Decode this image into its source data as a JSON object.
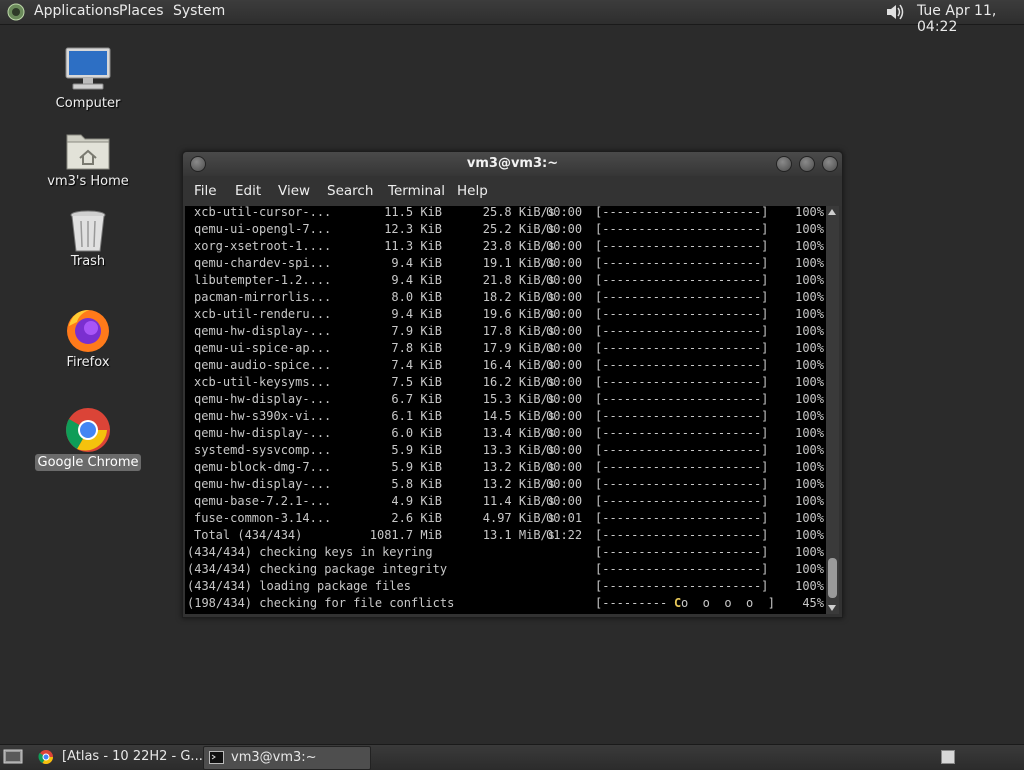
{
  "top_panel": {
    "menus": [
      "Applications",
      "Places",
      "System"
    ],
    "clock": "Tue Apr 11, 04:22"
  },
  "desktop_icons": [
    {
      "label": "Computer",
      "icon": "computer-icon"
    },
    {
      "label": "vm3's Home",
      "icon": "home-folder-icon"
    },
    {
      "label": "Trash",
      "icon": "trash-icon"
    },
    {
      "label": "Firefox",
      "icon": "firefox-icon"
    },
    {
      "label": "Google Chrome",
      "icon": "chrome-icon",
      "selected": true
    }
  ],
  "window": {
    "title": "vm3@vm3:~",
    "menu": [
      "File",
      "Edit",
      "View",
      "Search",
      "Terminal",
      "Help"
    ]
  },
  "terminal": {
    "downloads": [
      {
        "name": "xcb-util-cursor-...",
        "size": "11.5 KiB",
        "rate": "25.8 KiB/s",
        "time": "00:00",
        "bar": "[----------------------]",
        "pct": "100%"
      },
      {
        "name": "qemu-ui-opengl-7...",
        "size": "12.3 KiB",
        "rate": "25.2 KiB/s",
        "time": "00:00",
        "bar": "[----------------------]",
        "pct": "100%"
      },
      {
        "name": "xorg-xsetroot-1....",
        "size": "11.3 KiB",
        "rate": "23.8 KiB/s",
        "time": "00:00",
        "bar": "[----------------------]",
        "pct": "100%"
      },
      {
        "name": "qemu-chardev-spi...",
        "size": "9.4 KiB",
        "rate": "19.1 KiB/s",
        "time": "00:00",
        "bar": "[----------------------]",
        "pct": "100%"
      },
      {
        "name": "libutempter-1.2....",
        "size": "9.4 KiB",
        "rate": "21.8 KiB/s",
        "time": "00:00",
        "bar": "[----------------------]",
        "pct": "100%"
      },
      {
        "name": "pacman-mirrorlis...",
        "size": "8.0 KiB",
        "rate": "18.2 KiB/s",
        "time": "00:00",
        "bar": "[----------------------]",
        "pct": "100%"
      },
      {
        "name": "xcb-util-renderu...",
        "size": "9.4 KiB",
        "rate": "19.6 KiB/s",
        "time": "00:00",
        "bar": "[----------------------]",
        "pct": "100%"
      },
      {
        "name": "qemu-hw-display-...",
        "size": "7.9 KiB",
        "rate": "17.8 KiB/s",
        "time": "00:00",
        "bar": "[----------------------]",
        "pct": "100%"
      },
      {
        "name": "qemu-ui-spice-ap...",
        "size": "7.8 KiB",
        "rate": "17.9 KiB/s",
        "time": "00:00",
        "bar": "[----------------------]",
        "pct": "100%"
      },
      {
        "name": "qemu-audio-spice...",
        "size": "7.4 KiB",
        "rate": "16.4 KiB/s",
        "time": "00:00",
        "bar": "[----------------------]",
        "pct": "100%"
      },
      {
        "name": "xcb-util-keysyms...",
        "size": "7.5 KiB",
        "rate": "16.2 KiB/s",
        "time": "00:00",
        "bar": "[----------------------]",
        "pct": "100%"
      },
      {
        "name": "qemu-hw-display-...",
        "size": "6.7 KiB",
        "rate": "15.3 KiB/s",
        "time": "00:00",
        "bar": "[----------------------]",
        "pct": "100%"
      },
      {
        "name": "qemu-hw-s390x-vi...",
        "size": "6.1 KiB",
        "rate": "14.5 KiB/s",
        "time": "00:00",
        "bar": "[----------------------]",
        "pct": "100%"
      },
      {
        "name": "qemu-hw-display-...",
        "size": "6.0 KiB",
        "rate": "13.4 KiB/s",
        "time": "00:00",
        "bar": "[----------------------]",
        "pct": "100%"
      },
      {
        "name": "systemd-sysvcomp...",
        "size": "5.9 KiB",
        "rate": "13.3 KiB/s",
        "time": "00:00",
        "bar": "[----------------------]",
        "pct": "100%"
      },
      {
        "name": "qemu-block-dmg-7...",
        "size": "5.9 KiB",
        "rate": "13.2 KiB/s",
        "time": "00:00",
        "bar": "[----------------------]",
        "pct": "100%"
      },
      {
        "name": "qemu-hw-display-...",
        "size": "5.8 KiB",
        "rate": "13.2 KiB/s",
        "time": "00:00",
        "bar": "[----------------------]",
        "pct": "100%"
      },
      {
        "name": "qemu-base-7.2.1-...",
        "size": "4.9 KiB",
        "rate": "11.4 KiB/s",
        "time": "00:00",
        "bar": "[----------------------]",
        "pct": "100%"
      },
      {
        "name": "fuse-common-3.14...",
        "size": "2.6 KiB",
        "rate": "4.97 KiB/s",
        "time": "00:01",
        "bar": "[----------------------]",
        "pct": "100%"
      },
      {
        "name": "Total (434/434)",
        "size": "1081.7 MiB",
        "rate": "13.1 MiB/s",
        "time": "01:22",
        "bar": "[----------------------]",
        "pct": "100%"
      }
    ],
    "steps": [
      {
        "label": "(434/434) checking keys in keyring",
        "bar": "[----------------------]",
        "pct": "100%"
      },
      {
        "label": "(434/434) checking package integrity",
        "bar": "[----------------------]",
        "pct": "100%"
      },
      {
        "label": "(434/434) loading package files",
        "bar": "[----------------------]",
        "pct": "100%"
      },
      {
        "label": "(198/434) checking for file conflicts",
        "bar_done": "[---------",
        "pacman": "C",
        "bar_rest": "o  o  o  o  ]",
        "pct": "45%"
      }
    ]
  },
  "bottom_panel": {
    "tasks": [
      {
        "label": "[Atlas - 10 22H2 - G...",
        "icon": "chrome-icon"
      },
      {
        "label": "vm3@vm3:~",
        "icon": "terminal-icon",
        "active": true
      }
    ]
  }
}
